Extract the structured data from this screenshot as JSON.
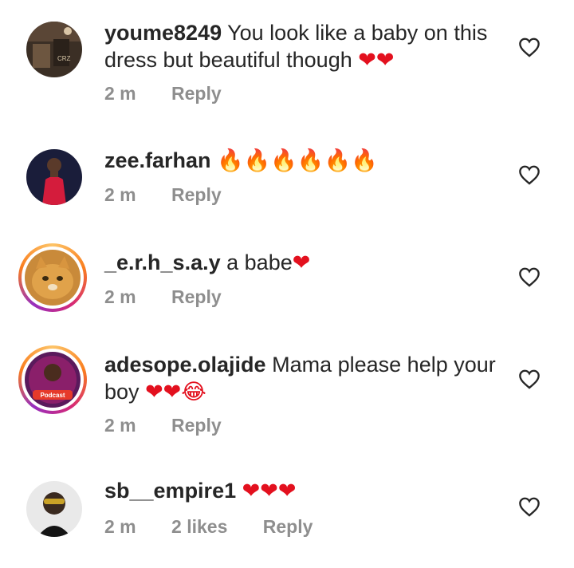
{
  "comments": [
    {
      "username": "youme8249",
      "text": "You look like a baby on this dress but beautiful though",
      "emoji": "❤❤",
      "time": "2 m",
      "likes": "",
      "reply": "Reply",
      "avatar_text": "CRZ"
    },
    {
      "username": "zee.farhan",
      "text": "",
      "emoji": "🔥🔥🔥🔥🔥🔥",
      "time": "2 m",
      "likes": "",
      "reply": "Reply"
    },
    {
      "username": "_e.r.h_s.a.y",
      "text": "a babe",
      "emoji": "❤",
      "time": "2 m",
      "likes": "",
      "reply": "Reply"
    },
    {
      "username": "adesope.olajide",
      "text": "Mama please help your boy",
      "emoji": "❤❤😂",
      "time": "2 m",
      "likes": "",
      "reply": "Reply",
      "avatar_text": "Podcast"
    },
    {
      "username": "sb__empire1",
      "text": "",
      "emoji": "❤❤❤",
      "time": "2 m",
      "likes": "2 likes",
      "reply": "Reply"
    }
  ],
  "colors": {
    "text": "#262626",
    "meta": "#8e8e8e",
    "heart": "#e3101e",
    "story_ring": "#d62976"
  },
  "icons": {
    "like": "heart-outline-icon"
  }
}
